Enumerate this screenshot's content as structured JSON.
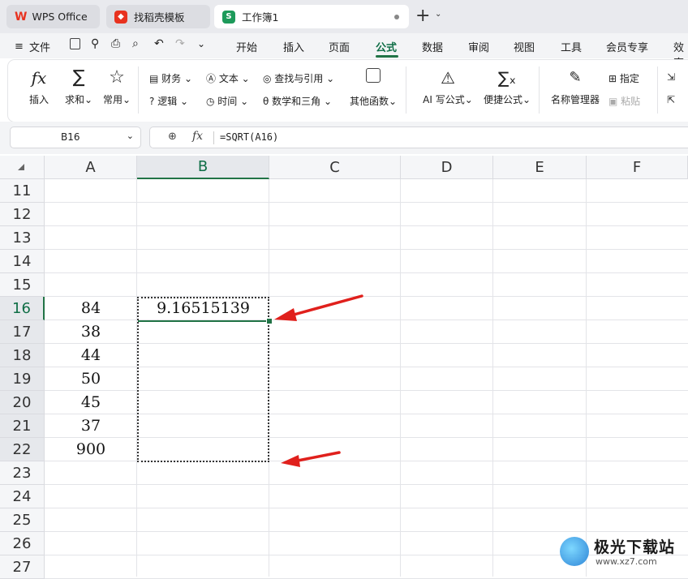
{
  "tabs": [
    {
      "label": "WPS Office",
      "icon": "wps-logo-icon"
    },
    {
      "label": "找稻壳模板",
      "icon": "docer-icon"
    },
    {
      "label": "工作簿1",
      "icon": "sheet-s-icon",
      "icon_text": "S",
      "active": true
    }
  ],
  "menu": [
    "文件",
    "开始",
    "插入",
    "页面",
    "公式",
    "数据",
    "审阅",
    "视图",
    "工具",
    "会员专享",
    "效率"
  ],
  "active_menu": "公式",
  "ribbon": {
    "insert": "插入",
    "sum": "求和",
    "common": "常用",
    "finance": "财务",
    "text": "文本",
    "lookup": "查找与引用",
    "logic": "逻辑",
    "time": "时间",
    "math": "数学和三角",
    "other": "其他函数",
    "ai": "AI 写公式",
    "quick": "便捷公式",
    "name_mgr": "名称管理器",
    "assign": "指定",
    "paste": "粘贴"
  },
  "name_box": "B16",
  "formula": "=SQRT(A16)",
  "fx_label": "fx",
  "columns": [
    "A",
    "B",
    "C",
    "D",
    "E",
    "F"
  ],
  "rows": [
    "11",
    "12",
    "13",
    "14",
    "15",
    "16",
    "17",
    "18",
    "19",
    "20",
    "21",
    "22",
    "23",
    "24",
    "25",
    "26",
    "27"
  ],
  "colA": {
    "16": "84",
    "17": "38",
    "18": "44",
    "19": "50",
    "20": "45",
    "21": "37",
    "22": "900"
  },
  "colB": {
    "16": "9.16515139"
  },
  "active_cell": "B16",
  "selection": "B16:B22",
  "accent": "#217346",
  "arrow_color": "#e0201c",
  "watermark": {
    "text": "极光下载站",
    "url": "www.xz7.com"
  }
}
